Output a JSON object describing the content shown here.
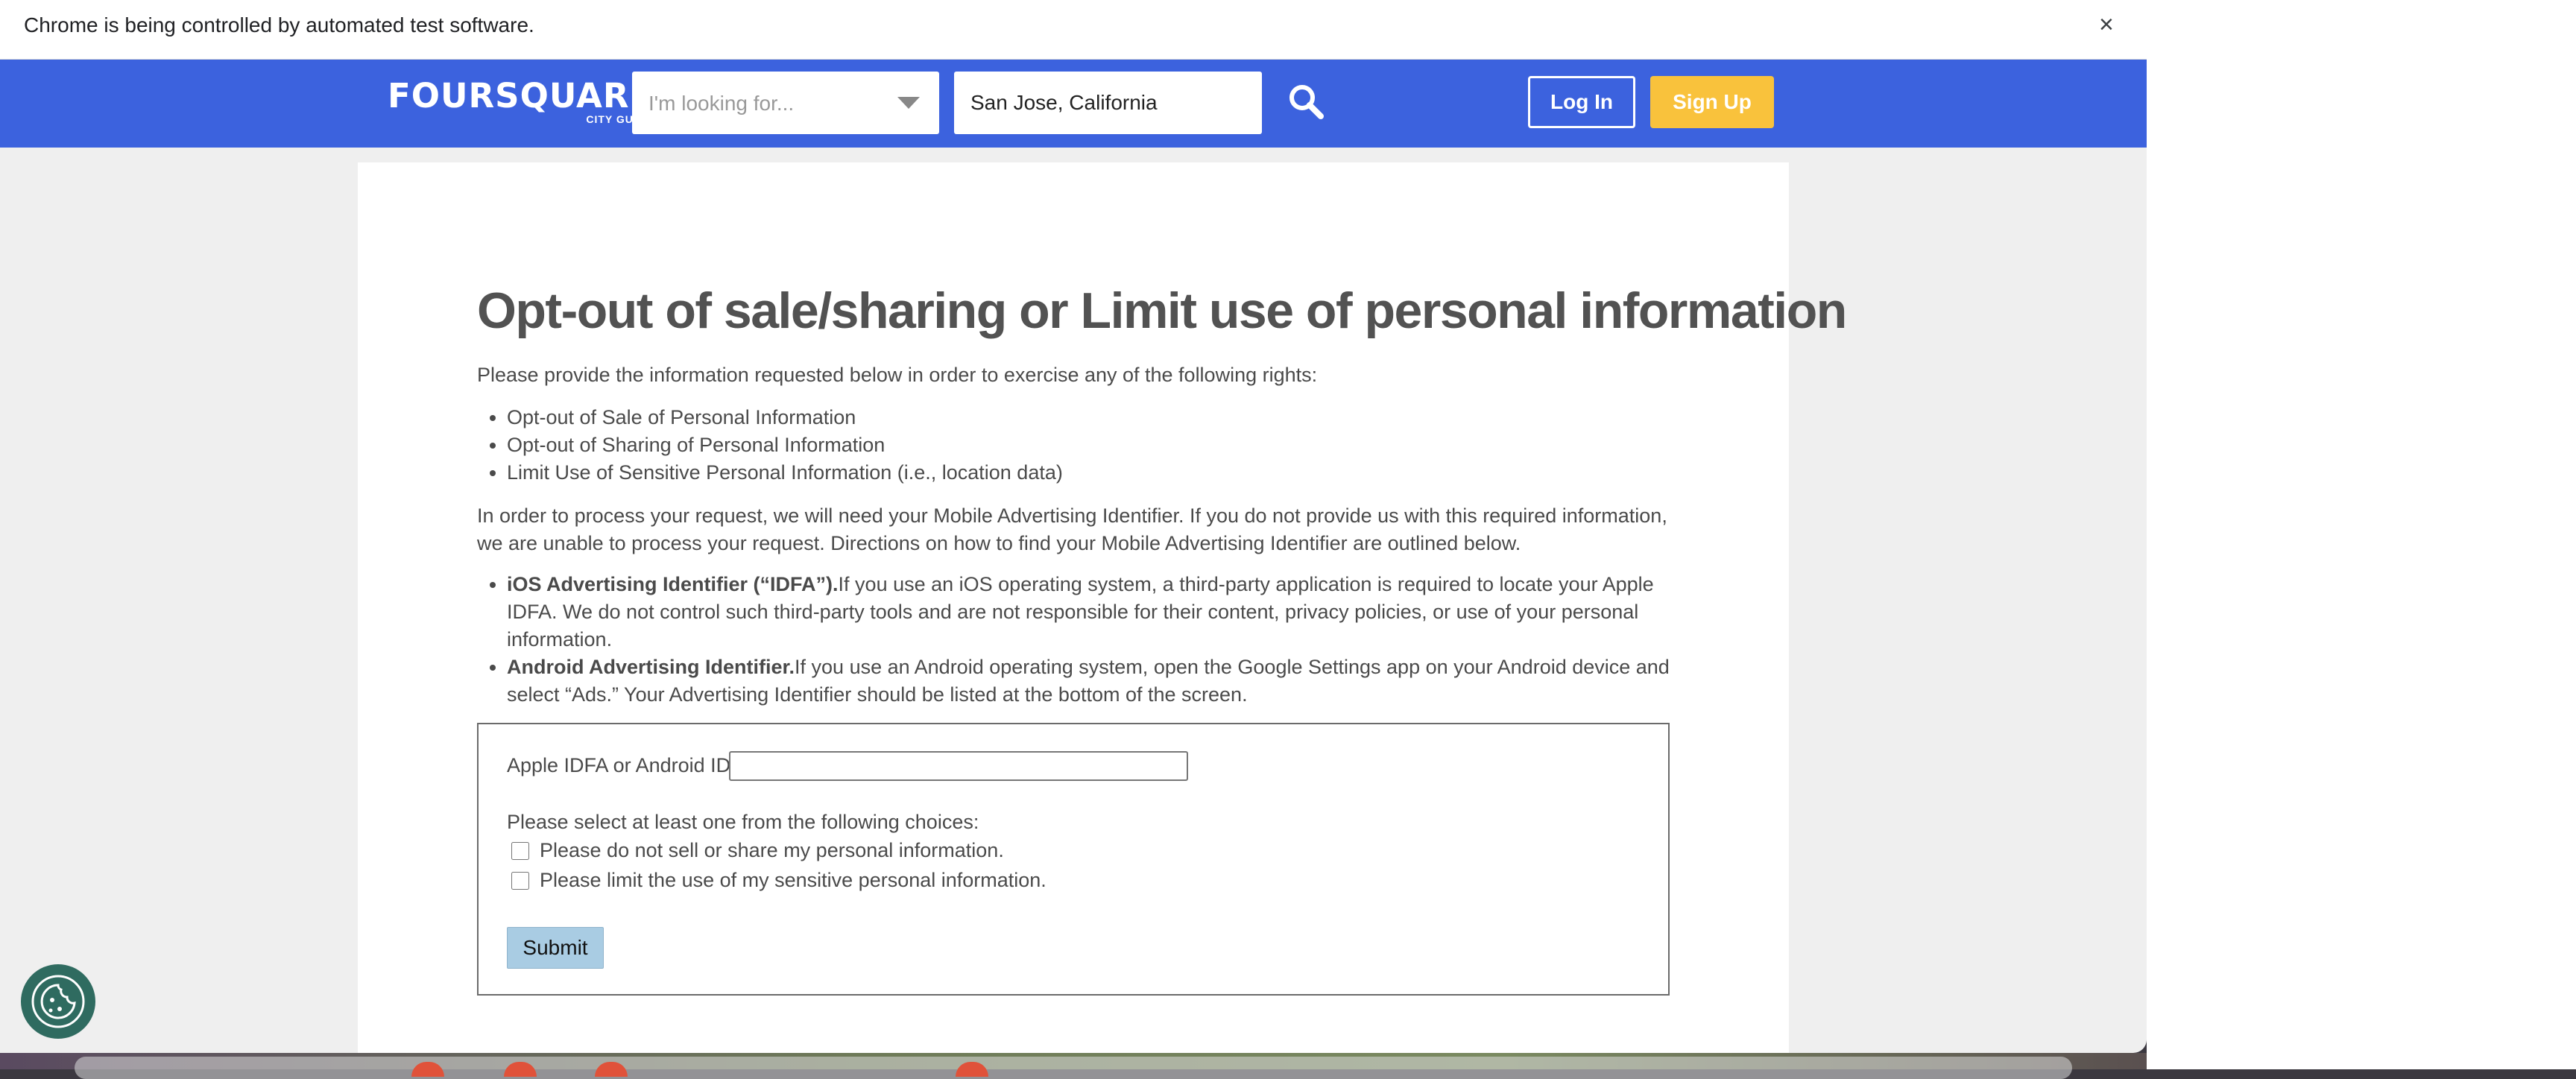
{
  "browser": {
    "infobar_text": "Chrome is being controlled by automated test software.",
    "infobar_close": "×"
  },
  "header": {
    "logo_main": "FOURSQUARE",
    "logo_sub": "CITY GUIDE",
    "looking_for_placeholder": "I'm looking for...",
    "location_value": "San Jose, California",
    "search_icon": "search-icon",
    "login_label": "Log In",
    "signup_label": "Sign Up",
    "colors": {
      "bar": "#3c62de",
      "signup": "#f9c23c"
    }
  },
  "main": {
    "title": "Opt-out of sale/sharing or Limit use of personal information",
    "intro": "Please provide the information requested below in order to exercise any of the following rights:",
    "rights": [
      "Opt-out of Sale of Personal Information",
      "Opt-out of Sharing of Personal Information",
      "Limit Use of Sensitive Personal Information (i.e., location data)"
    ],
    "process_text": "In order to process your request, we will need your Mobile Advertising Identifier. If you do not provide us with this required information, we are unable to process your request. Directions on how to find your Mobile Advertising Identifier are outlined below.",
    "identifiers": [
      {
        "heading": "iOS Advertising Identifier (“IDFA”).",
        "text": "If you use an iOS operating system, a third-party application is required to locate your Apple IDFA. We do not control such third-party tools and are not responsible for their content, privacy policies, or use of your personal information."
      },
      {
        "heading": "Android Advertising Identifier.",
        "text": "If you use an Android operating system, open the Google Settings app on your Android device and select “Ads.” Your Advertising Identifier should be listed at the bottom of the screen."
      }
    ]
  },
  "form": {
    "idfa_label": "Apple IDFA or Android ID",
    "idfa_value": "",
    "choices_label": "Please select at least one from the following choices:",
    "choices": [
      "Please do not sell or share my personal information.",
      "Please limit the use of my sensitive personal information."
    ],
    "submit_label": "Submit"
  },
  "cookie_icon": "cookie-icon"
}
